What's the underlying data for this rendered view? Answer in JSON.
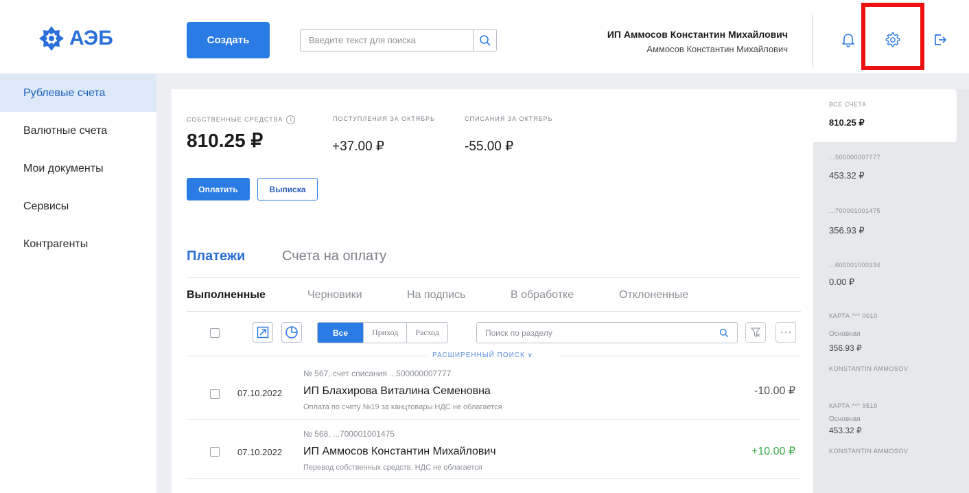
{
  "header": {
    "logo_text": "АЭБ",
    "create_label": "Создать",
    "search_placeholder": "Введите текст для поиска",
    "user_name": "ИП Аммосов Константин Михайлович",
    "user_sub": "Аммосов Константин Михайлович"
  },
  "sidebar": {
    "items": [
      {
        "label": "Рублевые счета"
      },
      {
        "label": "Валютные счета"
      },
      {
        "label": "Мои документы"
      },
      {
        "label": "Сервисы"
      },
      {
        "label": "Контрагенты"
      }
    ]
  },
  "balance": {
    "own_label": "СОБСТВЕННЫЕ СРЕДСТВА",
    "own_value": "810.25 ₽",
    "income_label": "ПОСТУПЛЕНИЯ ЗА ОКТЯБРЬ",
    "income_value": "+37.00 ₽",
    "outgo_label": "СПИСАНИЯ ЗА ОКТЯБРЬ",
    "outgo_value": "-55.00 ₽",
    "pay_label": "Оплатить",
    "statement_label": "Выписка"
  },
  "tabs": {
    "payments": "Платежи",
    "invoices": "Счета на оплату"
  },
  "subtabs": [
    "Выполненные",
    "Черновики",
    "На подпись",
    "В обработке",
    "Отклоненные"
  ],
  "filter": {
    "all": "Все",
    "income": "Приход",
    "expense": "Расход",
    "section_search_placeholder": "Поиск по разделу",
    "advanced_search": "РАСШИРЕННЫЙ ПОИСК"
  },
  "payments": [
    {
      "date": "07.10.2022",
      "meta": "№ 567, счет списания ...500000007777",
      "name": "ИП Блахирова Виталина Семеновна",
      "desc": "Оплата по счету №19 за канцтовары НДС не облагается",
      "amount": "-10.00 ₽",
      "amount_color": "#555555"
    },
    {
      "date": "07.10.2022",
      "meta": "№ 568, ...700001001475",
      "name": "ИП Аммосов Константин Михайлович",
      "desc": "Перевод собственных средств. НДС не облагается",
      "amount": "+10.00 ₽",
      "amount_color": "#3aa84a"
    }
  ],
  "accounts": {
    "all_label": "ВСЕ СЧЕТА",
    "all_value": "810.25 ₽",
    "list": [
      {
        "label": "...500000007777",
        "value": "453.32 ₽"
      },
      {
        "label": "...700001001475",
        "value": "356.93 ₽"
      },
      {
        "label": "...600001000334",
        "value": "0.00 ₽"
      }
    ],
    "cards": [
      {
        "label": "КАРТА *** 0010",
        "type": "Основная",
        "value": "356.93 ₽",
        "holder": "KONSTANTIN AMMOSOV"
      },
      {
        "label": "КАРТА *** 9519",
        "type": "Основная",
        "value": "453.32 ₽",
        "holder": "KONSTANTIN AMMOSOV"
      }
    ]
  },
  "colors": {
    "accent": "#2b7be5",
    "highlight": "#ee1111"
  }
}
